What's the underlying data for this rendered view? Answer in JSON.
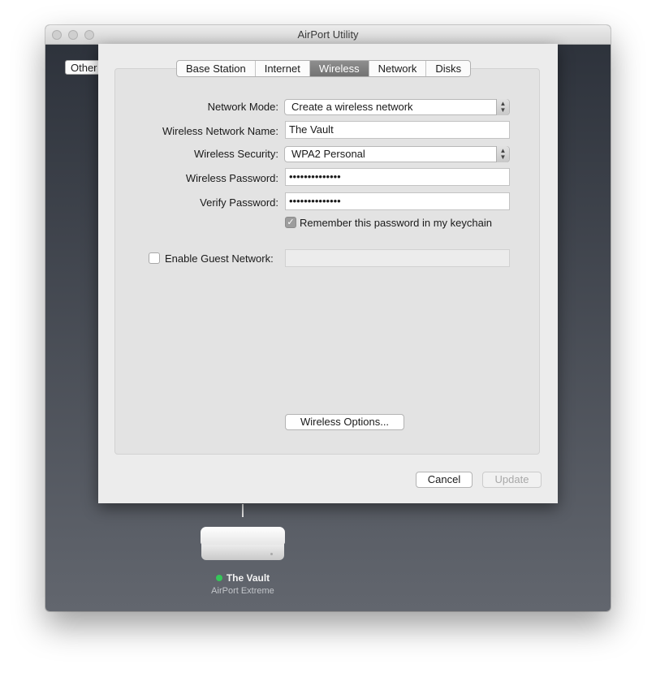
{
  "window": {
    "title": "AirPort Utility"
  },
  "background": {
    "other_button": "Other",
    "device": {
      "name": "The Vault",
      "model": "AirPort Extreme",
      "status_color": "#35c759"
    }
  },
  "tabs": [
    {
      "label": "Base Station",
      "selected": false
    },
    {
      "label": "Internet",
      "selected": false
    },
    {
      "label": "Wireless",
      "selected": true
    },
    {
      "label": "Network",
      "selected": false
    },
    {
      "label": "Disks",
      "selected": false
    }
  ],
  "form": {
    "network_mode": {
      "label": "Network Mode:",
      "value": "Create a wireless network"
    },
    "network_name": {
      "label": "Wireless Network Name:",
      "value": "The Vault"
    },
    "security": {
      "label": "Wireless Security:",
      "value": "WPA2 Personal"
    },
    "password": {
      "label": "Wireless Password:",
      "value": "••••••••••••••"
    },
    "verify": {
      "label": "Verify Password:",
      "value": "••••••••••••••"
    },
    "remember": {
      "label": "Remember this password in my keychain",
      "checked": true
    },
    "guest": {
      "label": "Enable Guest Network:",
      "checked": false,
      "value": ""
    }
  },
  "buttons": {
    "wireless_options": "Wireless Options...",
    "cancel": "Cancel",
    "update": "Update"
  }
}
